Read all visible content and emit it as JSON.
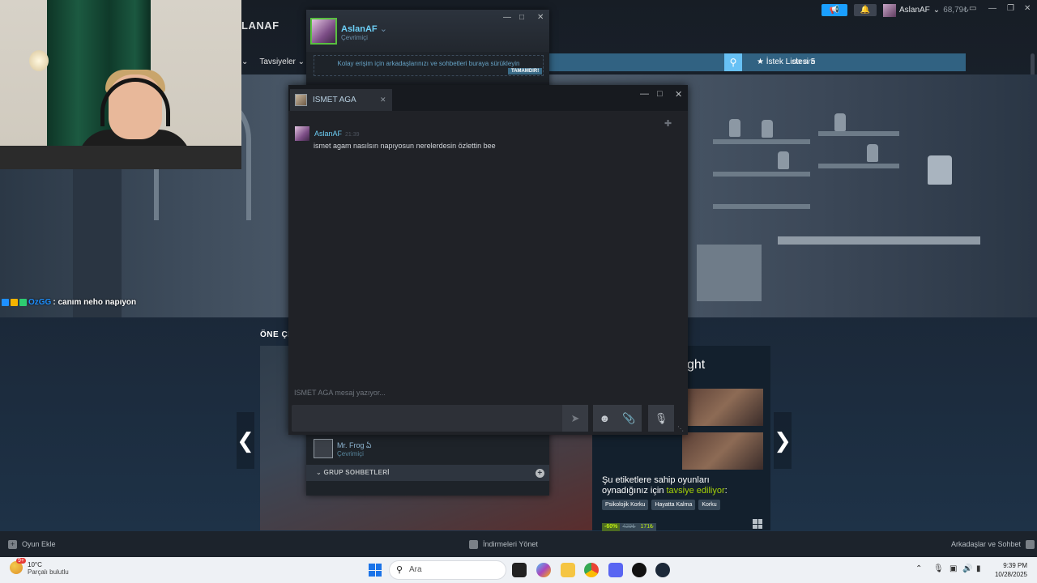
{
  "steam": {
    "store_name": "LANAF",
    "account_name": "AslanAF",
    "account_balance": "68,79₺",
    "nav_tavsiyeler": "Tavsiyeler",
    "search_placeholder": "da ara",
    "wishlist_label": "İstek Listesi",
    "wishlist_count": "5",
    "featured_title": "ÖNE ÇI",
    "game_title_partial": "ght",
    "reco_line1": "Şu etiketlere sahip oyunları",
    "reco_line2a": "oynadığınız için ",
    "reco_line2b": "tavsiye ediliyor",
    "reco_line2c": ":",
    "tags": [
      "Psikolojik Korku",
      "Hayatta Kalma",
      "Korku"
    ],
    "price": {
      "discount": "-60%",
      "original": "429₺",
      "final": "171₺"
    },
    "bottom": {
      "add_game": "Oyun Ekle",
      "downloads": "İndirmeleri Yönet",
      "friends_chat": "Arkadaşlar ve Sohbet"
    }
  },
  "overlay": {
    "chat_user": "OzGG",
    "chat_message": ": canım neho napıyon"
  },
  "friends": {
    "self_name": "AslanAF",
    "self_status": "Çevrimiçi",
    "hint": "Kolay erişim için arkadaşlarınızı ve sohbetleri buraya sürükleyin",
    "done_label": "TAMAMDIR!",
    "friend_name": "Mr. Frog",
    "friend_name_suffix": "ఏ",
    "friend_status": "Çevrimiçi",
    "group_label": "GRUP SOHBETLERİ"
  },
  "chat": {
    "tab_name": "ISMET AGA",
    "message_author": "AslanAF",
    "message_time": "21:39",
    "message_text": "ismet agam nasılsın napıyosun nerelerdesin özlettin bee",
    "typing_text": "ISMET AGA mesaj yazıyor..."
  },
  "taskbar": {
    "temp": "10°C",
    "weather": "Parçalı bulutlu",
    "weather_badge": "9+",
    "search_placeholder": "Ara",
    "time": "9:39 PM",
    "date": "10/28/2025"
  }
}
